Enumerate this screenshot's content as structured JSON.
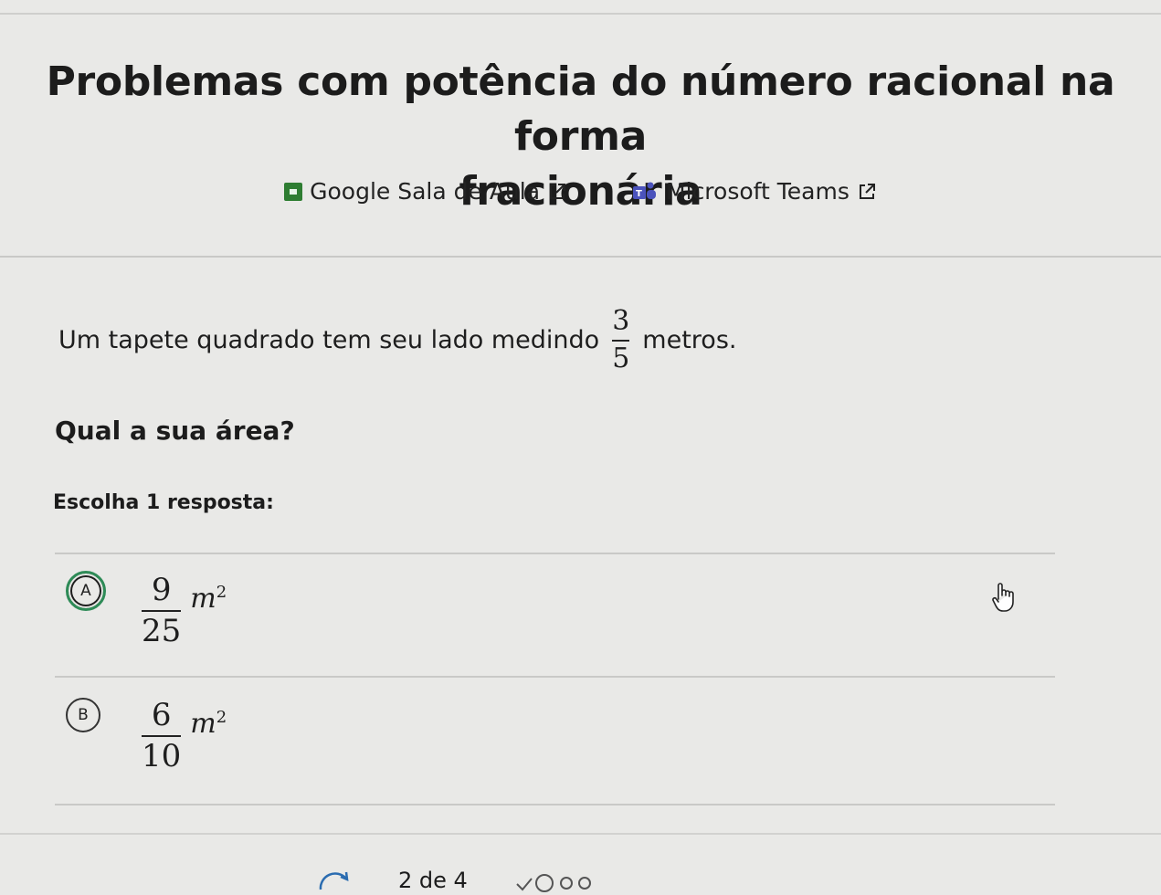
{
  "header": {
    "title_line1": "Problemas com potência do número racional na forma",
    "title_line2": "fracionária"
  },
  "share": {
    "google_classroom_label": "Google Sala de Aula",
    "microsoft_teams_label": "Microsoft Teams"
  },
  "question": {
    "text_before": "Um tapete quadrado tem seu lado medindo",
    "fraction_numerator": "3",
    "fraction_denominator": "5",
    "text_after": "metros.",
    "prompt": "Qual a sua área?",
    "instruction": "Escolha 1 resposta:"
  },
  "options": [
    {
      "letter": "A",
      "numerator": "9",
      "denominator": "25",
      "unit": "m",
      "exponent": "2",
      "selected": true
    },
    {
      "letter": "B",
      "numerator": "6",
      "denominator": "10",
      "unit": "m",
      "exponent": "2",
      "selected": false
    }
  ],
  "footer": {
    "pager_text": "2 de 4"
  },
  "colors": {
    "background": "#e9e9e7",
    "selected_ring": "#2e8b57",
    "classroom_green": "#2e7d32",
    "teams_purple": "#4b53bc"
  },
  "icons": [
    "google-classroom-icon",
    "microsoft-teams-icon",
    "external-link-icon",
    "hand-cursor-icon",
    "redo-icon"
  ]
}
